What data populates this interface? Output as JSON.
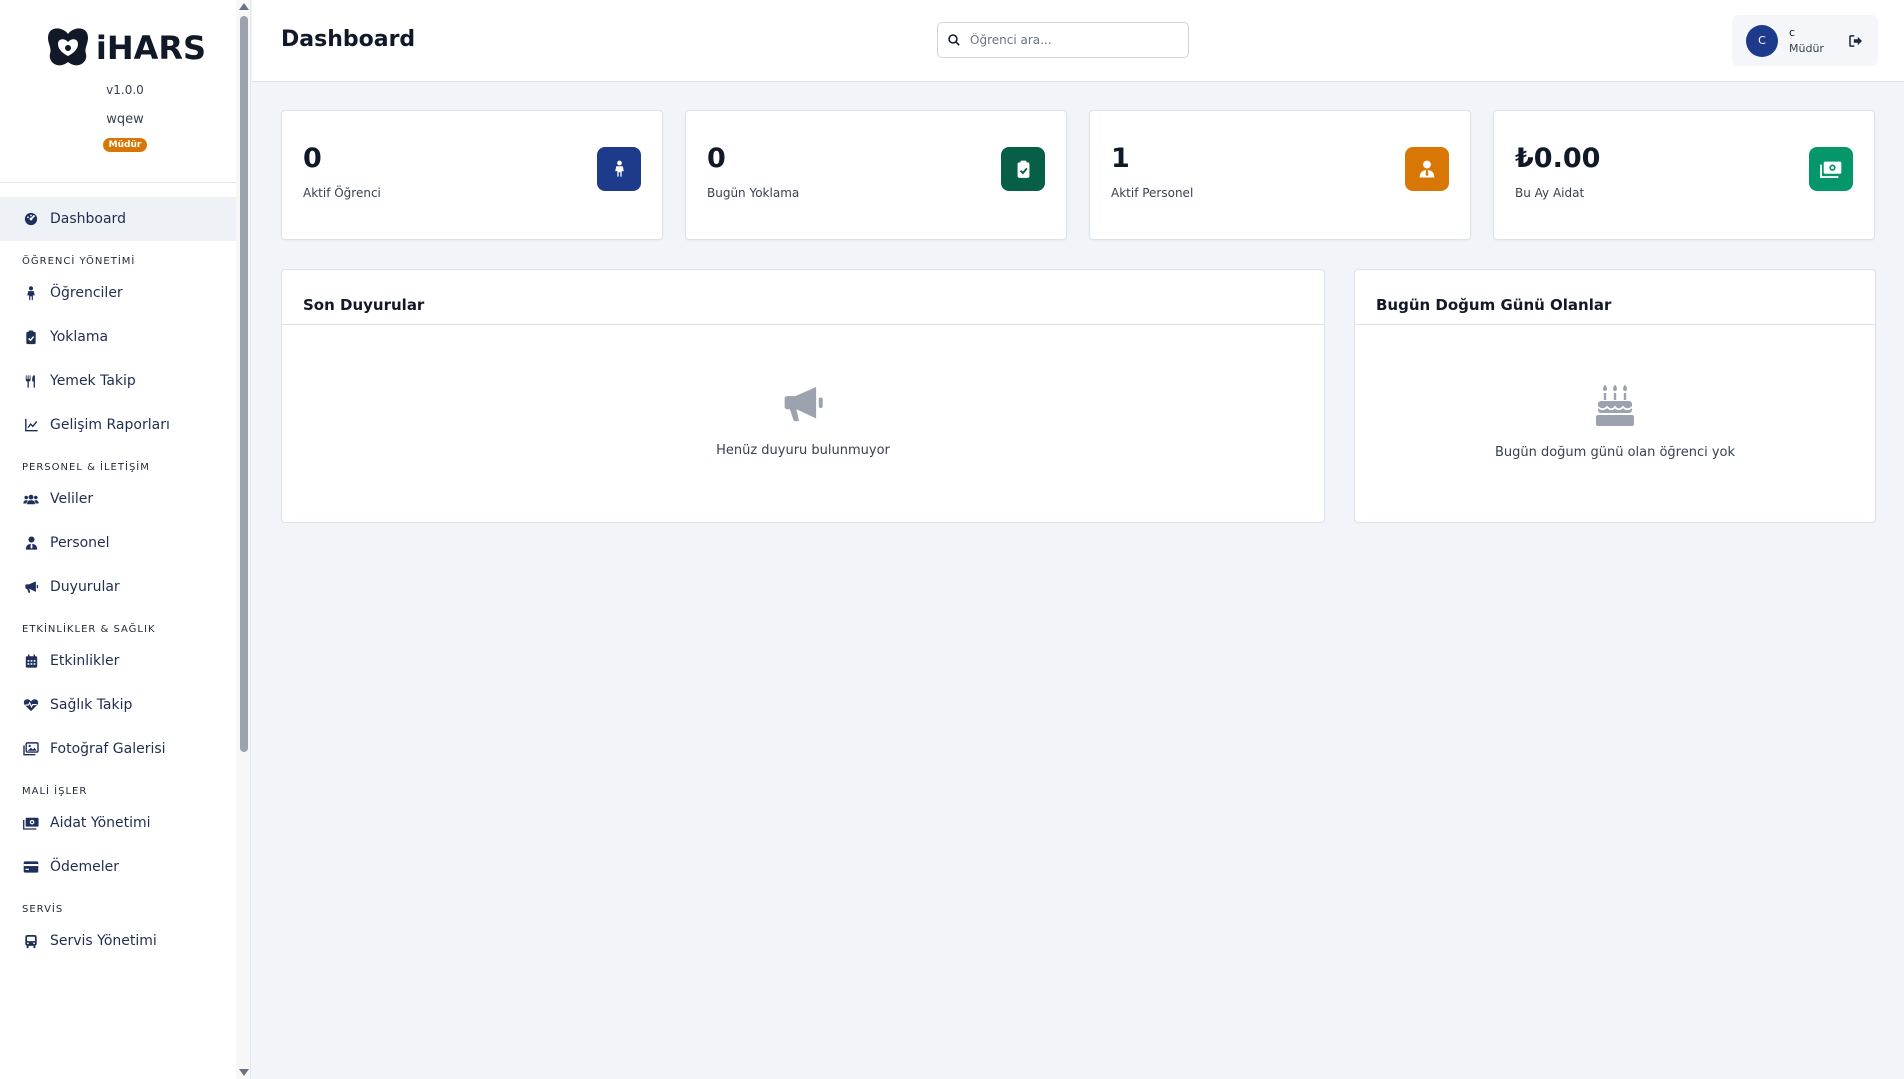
{
  "app": {
    "name": "iHARS",
    "version": "v1.0.0",
    "school": "wqew",
    "role_badge": "Müdür"
  },
  "nav": {
    "dashboard": "Dashboard",
    "sections": {
      "ogrenci": "ÖĞRENCİ YÖNETİMİ",
      "personel": "PERSONEL & İLETİŞİM",
      "etkinlik": "ETKİNLİKLER & SAĞLIK",
      "mali": "MALİ İŞLER",
      "servis": "SERVİS"
    },
    "items": {
      "ogrenciler": "Öğrenciler",
      "yoklama": "Yoklama",
      "yemek": "Yemek Takip",
      "gelisim": "Gelişim Raporları",
      "veliler": "Veliler",
      "personel": "Personel",
      "duyurular": "Duyurular",
      "etkinlikler": "Etkinlikler",
      "saglik": "Sağlık Takip",
      "galeri": "Fotoğraf Galerisi",
      "aidat": "Aidat Yönetimi",
      "odemeler": "Ödemeler",
      "servis": "Servis Yönetimi"
    }
  },
  "header": {
    "title": "Dashboard",
    "search_placeholder": "Öğrenci ara...",
    "user_initial": "C",
    "user_name": "c",
    "user_role": "Müdür"
  },
  "stats": [
    {
      "value": "0",
      "label": "Aktif Öğrenci",
      "icon": "child-icon",
      "color": "#1e3a8a"
    },
    {
      "value": "0",
      "label": "Bugün Yoklama",
      "icon": "clipboard-check-icon",
      "color": "#065f46"
    },
    {
      "value": "1",
      "label": "Aktif Personel",
      "icon": "user-tie-icon",
      "color": "#d97706"
    },
    {
      "value": "₺0.00",
      "label": "Bu Ay Aidat",
      "icon": "money-bill-icon",
      "color": "#059669"
    }
  ],
  "panels": {
    "announcements": {
      "title": "Son Duyurular",
      "empty": "Henüz duyuru bulunmuyor",
      "icon": "megaphone-icon"
    },
    "birthdays": {
      "title": "Bugün Doğum Günü Olanlar",
      "empty": "Bugün doğum günü olan öğrenci yok",
      "icon": "birthday-cake-icon"
    }
  },
  "colors": {
    "primary": "#1e3a8a",
    "background": "#f1f4f8",
    "badge": "#d97706"
  }
}
